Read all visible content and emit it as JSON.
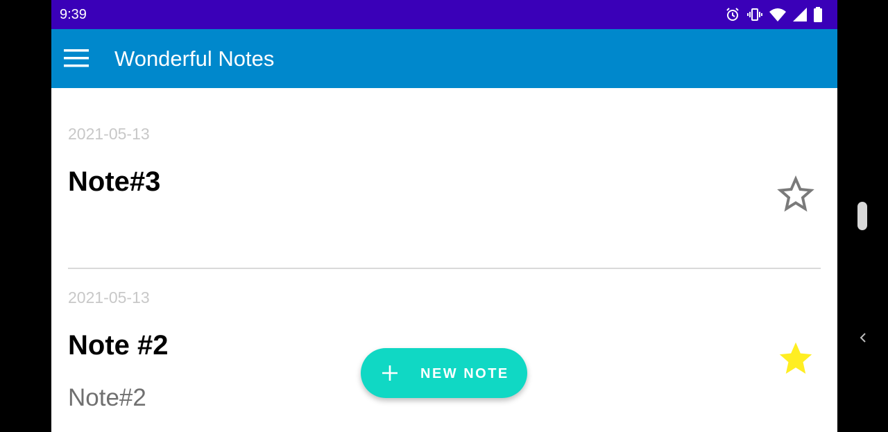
{
  "status_bar": {
    "time": "9:39",
    "icons": [
      "alarm-icon",
      "vibrate-icon",
      "wifi-icon",
      "signal-icon",
      "battery-icon"
    ]
  },
  "app_bar": {
    "title": "Wonderful Notes",
    "menu_icon": "hamburger-menu-icon",
    "color": "#0088cc"
  },
  "notes": [
    {
      "date": "2021-05-13",
      "title": "Note#3",
      "body": "",
      "starred": false
    },
    {
      "date": "2021-05-13",
      "title": "Note #2",
      "body": "Note#2",
      "starred": true
    }
  ],
  "fab": {
    "label": "NEW NOTE",
    "icon": "plus-icon",
    "color": "#10d8c4"
  },
  "colors": {
    "status_bar": "#3a00b8",
    "star_filled": "#ffee22",
    "star_outline": "#7a7a7a"
  }
}
